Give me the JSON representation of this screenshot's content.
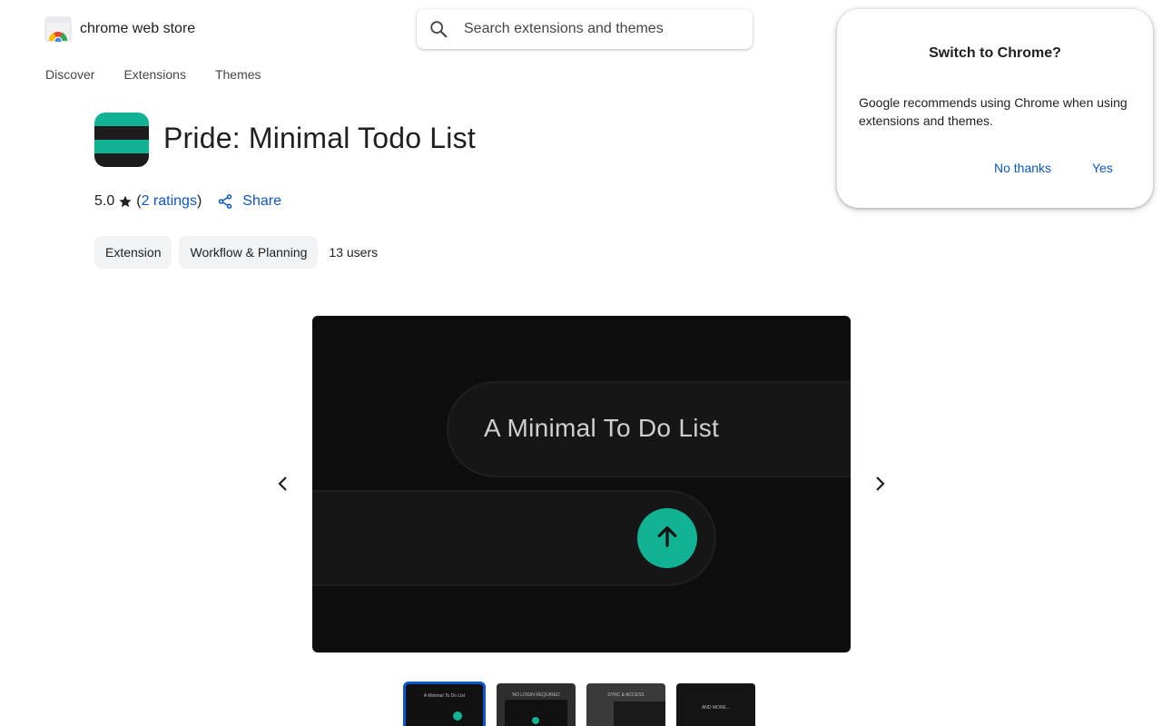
{
  "header": {
    "store_name": "chrome web store",
    "search": {
      "placeholder": "Search extensions and themes"
    },
    "nav": [
      "Discover",
      "Extensions",
      "Themes"
    ]
  },
  "item": {
    "title": "Pride: Minimal Todo List",
    "rating": "5.0",
    "ratings_link": "2 ratings",
    "share_label": "Share",
    "chips": [
      "Extension",
      "Workflow & Planning"
    ],
    "users": "13 users",
    "icon_colors": [
      "#12b394",
      "#1c1c1c",
      "#12b394",
      "#1c1c1c"
    ]
  },
  "carousel": {
    "slide_text": "A Minimal To Do List",
    "accent": "#12b394",
    "thumbnails": [
      {
        "label": "A Minimal To Do List",
        "active": true
      },
      {
        "label": "NO LOGIN REQUIRED",
        "active": false
      },
      {
        "label": "SYNC & ACCESS",
        "active": false
      },
      {
        "label": "AND MORE...",
        "active": false
      }
    ]
  },
  "dialog": {
    "title": "Switch to Chrome?",
    "body": "Google recommends using Chrome when using extensions and themes.",
    "no_label": "No thanks",
    "yes_label": "Yes"
  }
}
